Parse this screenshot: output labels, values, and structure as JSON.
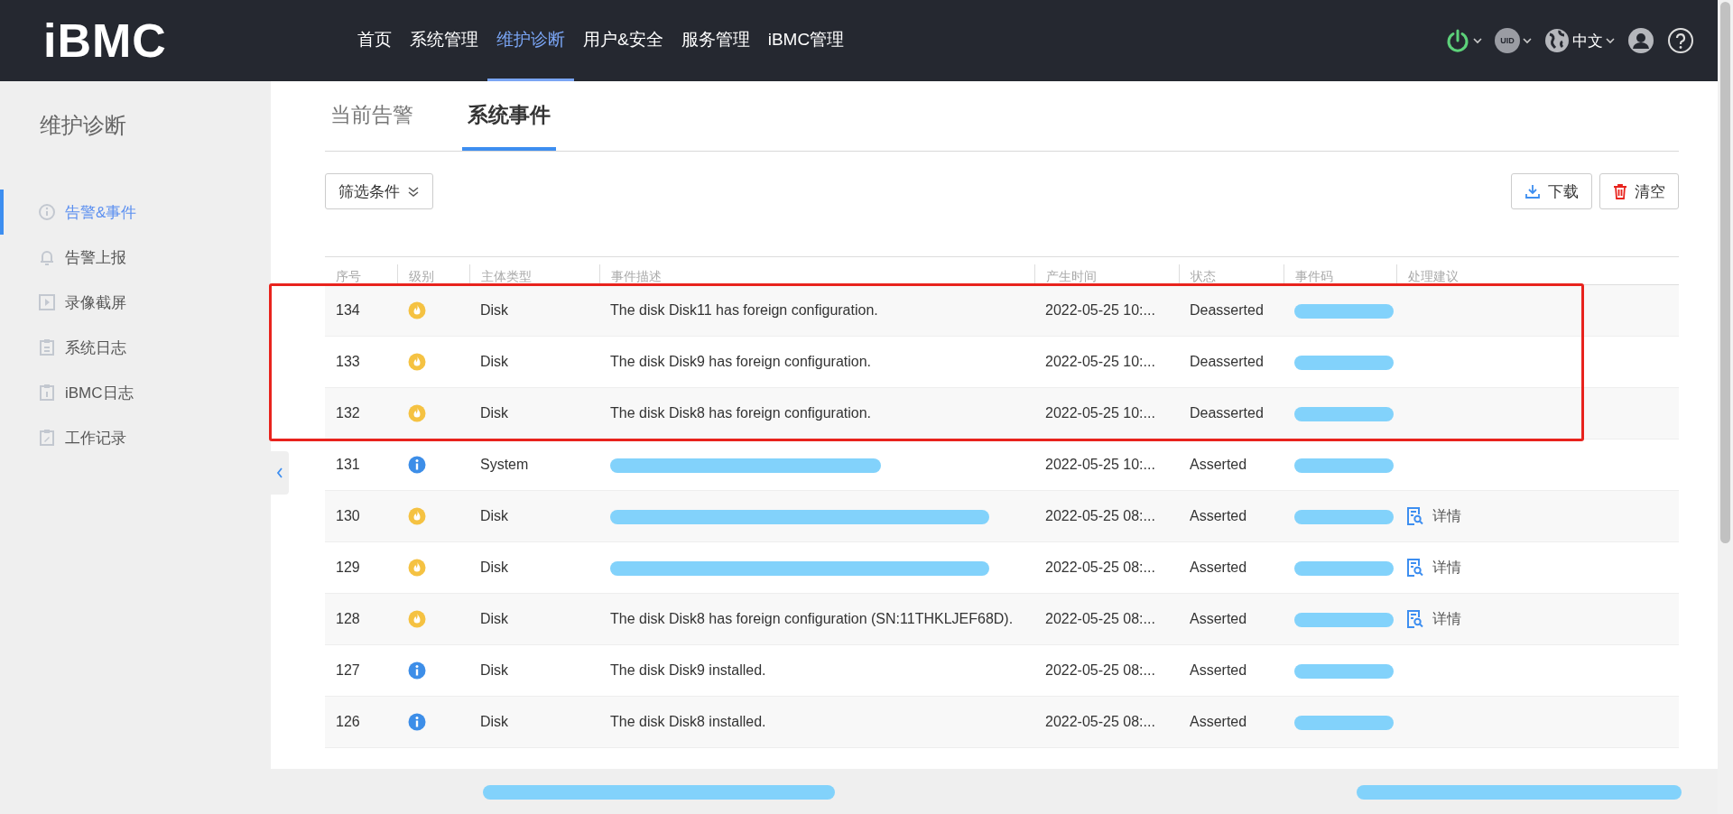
{
  "header": {
    "logo": "iBMC",
    "nav": [
      {
        "label": "首页",
        "selected": false
      },
      {
        "label": "系统管理",
        "selected": false
      },
      {
        "label": "维护诊断",
        "selected": true
      },
      {
        "label": "用户&安全",
        "selected": false
      },
      {
        "label": "服务管理",
        "selected": false
      },
      {
        "label": "iBMC管理",
        "selected": false
      }
    ],
    "uid": "UID",
    "language": "中文"
  },
  "sidebar": {
    "title": "维护诊断",
    "items": [
      {
        "label": "告警&事件",
        "selected": true
      },
      {
        "label": "告警上报",
        "selected": false
      },
      {
        "label": "录像截屏",
        "selected": false
      },
      {
        "label": "系统日志",
        "selected": false
      },
      {
        "label": "iBMC日志",
        "selected": false
      },
      {
        "label": "工作记录",
        "selected": false
      }
    ]
  },
  "tabs": [
    {
      "label": "当前告警",
      "selected": false
    },
    {
      "label": "系统事件",
      "selected": true
    }
  ],
  "toolbar": {
    "filter": "筛选条件",
    "download": "下载",
    "clear": "清空"
  },
  "table": {
    "columns": [
      "序号",
      "级别",
      "主体类型",
      "事件描述",
      "产生时间",
      "状态",
      "事件码",
      "处理建议"
    ],
    "rows": [
      {
        "id": "134",
        "kind": "warning",
        "subject": "Disk",
        "description": "The disk Disk11 has foreign configuration.",
        "time": "2022-05-25 10:...",
        "status": "Deasserted",
        "highlighted": true
      },
      {
        "id": "133",
        "kind": "warning",
        "subject": "Disk",
        "description": "The disk Disk9 has foreign configuration.",
        "time": "2022-05-25 10:...",
        "status": "Deasserted",
        "highlighted": true
      },
      {
        "id": "132",
        "kind": "warning",
        "subject": "Disk",
        "description": "The disk Disk8 has foreign configuration.",
        "time": "2022-05-25 10:...",
        "status": "Deasserted",
        "highlighted": true
      },
      {
        "id": "131",
        "kind": "info",
        "subject": "System",
        "description_redacted": true,
        "time": "2022-05-25 10:...",
        "status": "Asserted",
        "highlighted": false
      },
      {
        "id": "130",
        "kind": "warning",
        "subject": "Disk",
        "description_redacted": true,
        "time": "2022-05-25 08:...",
        "status": "Asserted",
        "highlighted": false,
        "advice": "详情"
      },
      {
        "id": "129",
        "kind": "warning",
        "subject": "Disk",
        "description_redacted": true,
        "time": "2022-05-25 08:...",
        "status": "Asserted",
        "highlighted": false,
        "advice": "详情"
      },
      {
        "id": "128",
        "kind": "warning",
        "subject": "Disk",
        "description": "The disk Disk8 has foreign configuration (SN:11THKLJEF68D).",
        "time": "2022-05-25 08:...",
        "status": "Asserted",
        "highlighted": false,
        "advice": "详情"
      },
      {
        "id": "127",
        "kind": "info",
        "subject": "Disk",
        "description": "The disk Disk9 installed.",
        "time": "2022-05-25 08:...",
        "status": "Asserted",
        "highlighted": false
      },
      {
        "id": "126",
        "kind": "info",
        "subject": "Disk",
        "description": "The disk Disk8 installed.",
        "time": "2022-05-25 08:...",
        "status": "Asserted",
        "highlighted": false
      }
    ]
  },
  "footer": {
    "left_redacted": true,
    "right_redacted": true
  }
}
